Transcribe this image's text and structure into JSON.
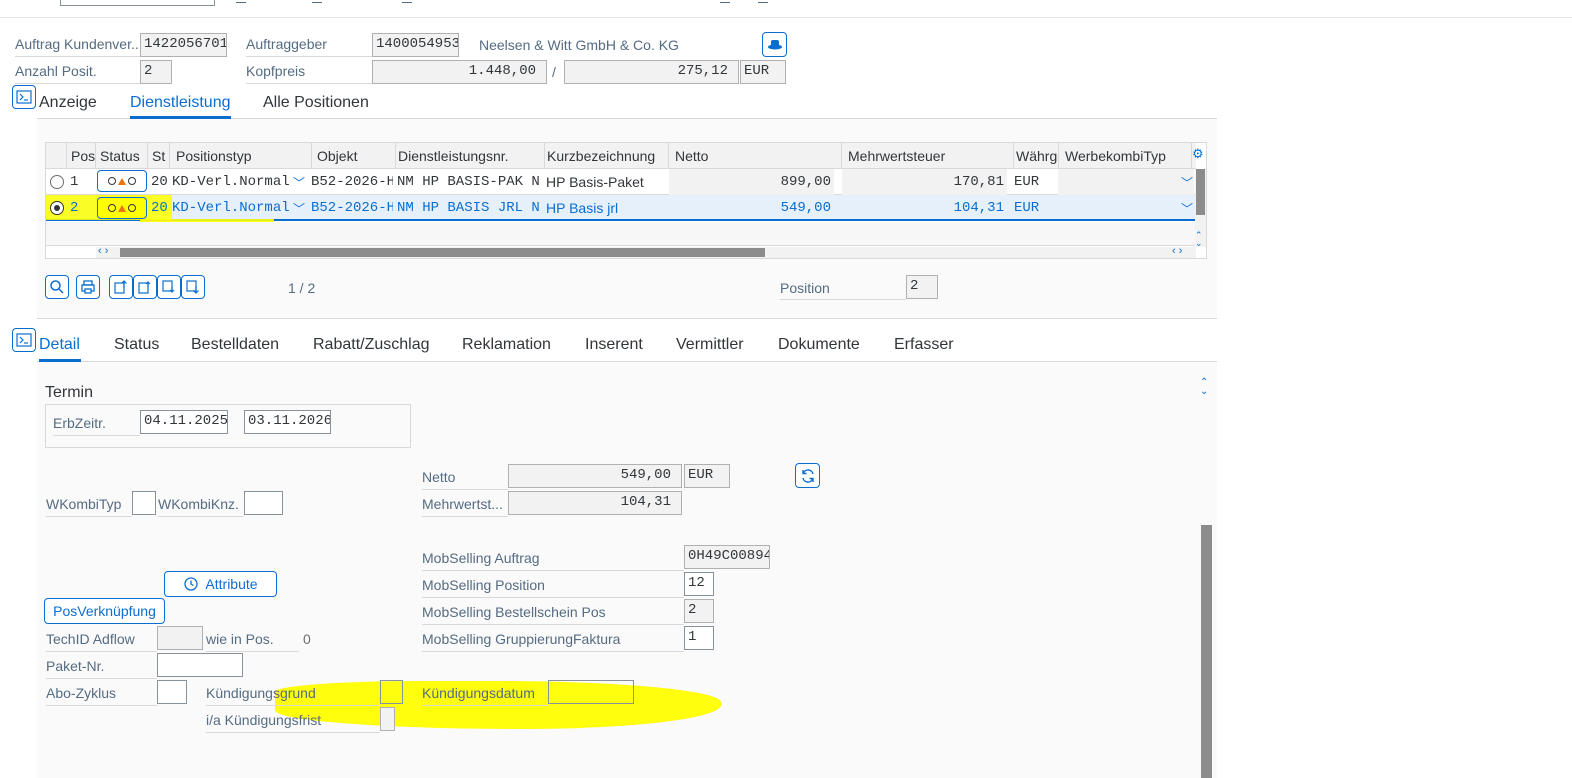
{
  "header": {
    "auftrag_label": "Auftrag Kundenver...",
    "auftrag_value": "1422056701",
    "auftraggeber_label": "Auftraggeber",
    "auftraggeber_value": "1400054953",
    "auftraggeber_name": "Neelsen & Witt GmbH & Co. KG",
    "anzahl_label": "Anzahl Posit.",
    "anzahl_value": "2",
    "kopfpreis_label": "Kopfpreis",
    "kopfpreis_value": "1.448,00",
    "separator": "/",
    "kopfpreis_value2": "275,12",
    "currency": "EUR"
  },
  "tabs_top": {
    "items": [
      "Anzeige",
      "Dienstleistung",
      "Alle Positionen"
    ],
    "active": "Dienstleistung"
  },
  "table": {
    "columns": [
      "Pos",
      "Status",
      "St",
      "Positionstyp",
      "Objekt",
      "Dienstleistungsnr.",
      "Kurzbezeichnung",
      "Netto",
      "Mehrwertsteuer",
      "Währg",
      "WerbekombiTyp"
    ],
    "rows": [
      {
        "pos": "1",
        "st": "20",
        "positionstyp": "KD-Verl.Normal",
        "objekt": "B52-2026-H",
        "dienstleistungsnr": "NM HP BASIS-PAK N",
        "kurz": "HP Basis-Paket",
        "netto": "899,00",
        "mwst": "170,81",
        "waehrg": "EUR",
        "werbekombityp": ""
      },
      {
        "pos": "2",
        "st": "20",
        "positionstyp": "KD-Verl.Normal",
        "objekt": "B52-2026-H",
        "dienstleistungsnr": "NM HP BASIS JRL N",
        "kurz": "HP Basis jrl",
        "netto": "549,00",
        "mwst": "104,31",
        "waehrg": "EUR",
        "werbekombityp": ""
      }
    ],
    "selected_row": 2,
    "page_indicator": "1 / 2",
    "position_label": "Position",
    "position_value": "2"
  },
  "tabs_detail": {
    "items": [
      "Detail",
      "Status",
      "Bestelldaten",
      "Rabatt/Zuschlag",
      "Reklamation",
      "Inserent",
      "Vermittler",
      "Dokumente",
      "Erfasser"
    ],
    "active": "Detail"
  },
  "detail": {
    "termin_title": "Termin",
    "erbzeitr_label": "ErbZeitr.",
    "erbzeitr_from": "04.11.2025",
    "erbzeitr_to": "03.11.2026",
    "netto_label": "Netto",
    "netto_value": "549,00",
    "netto_currency": "EUR",
    "mwst_label": "Mehrwertst...",
    "mwst_value": "104,31",
    "wkombityp_label": "WKombiTyp",
    "wkombiknz_label": "WKombiKnz.",
    "mob_auftrag_label": "MobSelling Auftrag",
    "mob_auftrag_value": "0H49C00894",
    "mob_position_label": "MobSelling Position",
    "mob_position_value": "12",
    "mob_bestell_label": "MobSelling Bestellschein Pos",
    "mob_bestell_value": "2",
    "mob_gruppierung_label": "MobSelling GruppierungFaktura",
    "mob_gruppierung_value": "1",
    "attribute_button": "Attribute",
    "posverknuepfung_button": "PosVerknüpfung",
    "techid_label": "TechID Adflow",
    "wie_in_pos_label": "wie in Pos.",
    "wie_in_pos_value": "0",
    "paket_label": "Paket-Nr.",
    "abo_label": "Abo-Zyklus",
    "kuendigungsgrund_label": "Kündigungsgrund",
    "kuendigungsdatum_label": "Kündigungsdatum",
    "kuendigungsfrist_label": "i/a Kündigungsfrist"
  },
  "colors": {
    "accent": "#0a6ed1",
    "highlight": "#ffff00",
    "label": "#556b82"
  }
}
